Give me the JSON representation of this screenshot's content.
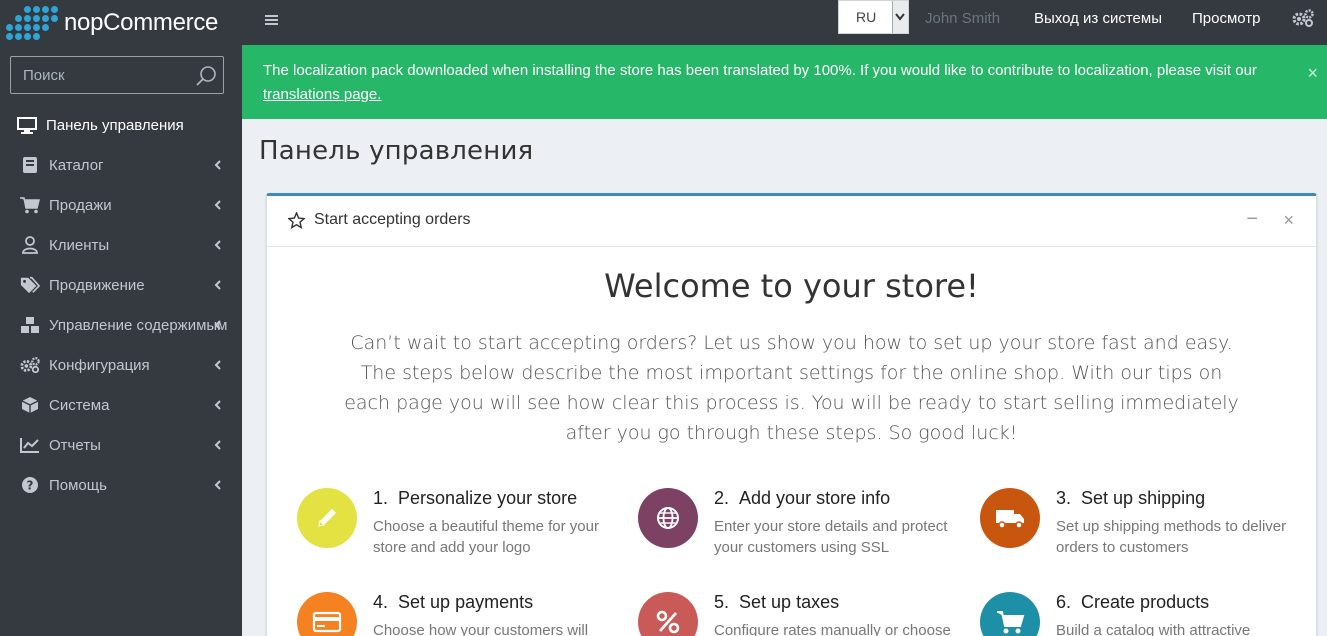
{
  "brand": {
    "name": "nopCommerce"
  },
  "search": {
    "placeholder": "Поиск"
  },
  "sidebar": {
    "items": [
      {
        "label": "Панель управления",
        "icon": "monitor-icon"
      },
      {
        "label": "Каталог",
        "icon": "book-icon"
      },
      {
        "label": "Продажи",
        "icon": "cart-icon"
      },
      {
        "label": "Клиенты",
        "icon": "user-icon"
      },
      {
        "label": "Продвижение",
        "icon": "tags-icon"
      },
      {
        "label": "Управление содержимым",
        "icon": "cubes-icon"
      },
      {
        "label": "Конфигурация",
        "icon": "cogs-icon"
      },
      {
        "label": "Система",
        "icon": "cube-icon"
      },
      {
        "label": "Отчеты",
        "icon": "line-chart-icon"
      },
      {
        "label": "Помощь",
        "icon": "question-icon"
      }
    ]
  },
  "topbar": {
    "language": "RU",
    "user": "John Smith",
    "logout": "Выход из системы",
    "view": "Просмотр"
  },
  "alert": {
    "text": "The localization pack downloaded when installing the store has been translated by 100%. If you would like to contribute to localization, please visit our ",
    "link": "translations page.",
    "close": "×"
  },
  "page": {
    "title": "Панель управления"
  },
  "card": {
    "title": "Start accepting orders",
    "minimize": "−",
    "close": "×",
    "welcome": "Welcome to your store!",
    "intro": "Can’t wait to start accepting orders? Let us show you how to set up your store fast and easy. The steps below describe the most important settings for the online shop. With our tips on each page you will see how clear this process is. You will be ready to start selling immediately after you go through these steps. So good luck!"
  },
  "steps": [
    {
      "number": "1.",
      "title": "Personalize your store",
      "desc": "Choose a beautiful theme for your store and add your logo",
      "color": "#e4e142",
      "icon": "pencil-icon"
    },
    {
      "number": "2.",
      "title": "Add your store info",
      "desc": "Enter your store details and protect your customers using SSL",
      "color": "#7d4263",
      "icon": "globe-icon"
    },
    {
      "number": "3.",
      "title": "Set up shipping",
      "desc": "Set up shipping methods to deliver orders to customers",
      "color": "#c8560f",
      "icon": "truck-icon"
    },
    {
      "number": "4.",
      "title": "Set up payments",
      "desc": "Choose how your customers will",
      "color": "#f58120",
      "icon": "credit-card-icon"
    },
    {
      "number": "5.",
      "title": "Set up taxes",
      "desc": "Configure rates manually or choose",
      "color": "#c95a58",
      "icon": "percent-icon"
    },
    {
      "number": "6.",
      "title": "Create products",
      "desc": "Build a catalog with attractive",
      "color": "#1d8fa6",
      "icon": "cart-icon"
    }
  ]
}
